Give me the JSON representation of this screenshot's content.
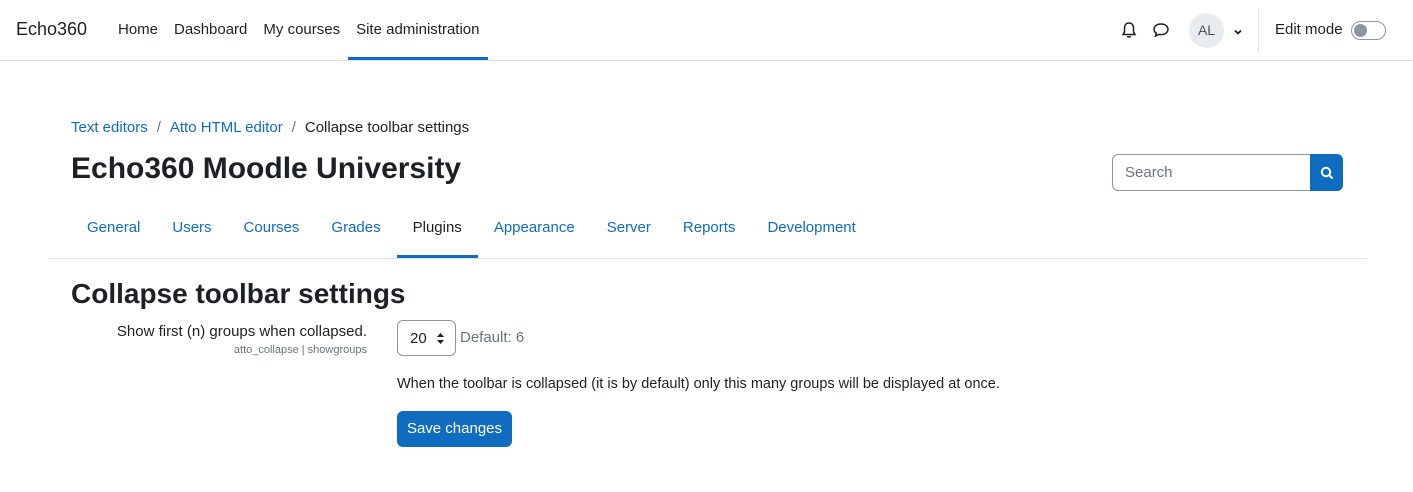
{
  "navbar": {
    "brand": "Echo360",
    "items": [
      {
        "label": "Home"
      },
      {
        "label": "Dashboard"
      },
      {
        "label": "My courses"
      },
      {
        "label": "Site administration"
      }
    ],
    "active_item": "Site administration",
    "avatar_initials": "AL",
    "edit_mode_label": "Edit mode",
    "edit_mode_on": false
  },
  "breadcrumb": {
    "items": [
      "Text editors",
      "Atto HTML editor"
    ],
    "current": "Collapse toolbar settings",
    "separator": "/"
  },
  "page_heading": "Echo360 Moodle University",
  "search": {
    "placeholder": "Search"
  },
  "tabs": [
    {
      "label": "General"
    },
    {
      "label": "Users"
    },
    {
      "label": "Courses"
    },
    {
      "label": "Grades"
    },
    {
      "label": "Plugins"
    },
    {
      "label": "Appearance"
    },
    {
      "label": "Server"
    },
    {
      "label": "Reports"
    },
    {
      "label": "Development"
    }
  ],
  "active_tab": "Plugins",
  "section_heading": "Collapse toolbar settings",
  "setting": {
    "label": "Show first (n) groups when collapsed.",
    "id": "atto_collapse | showgroups",
    "value": "20",
    "default": "Default: 6",
    "description": "When the toolbar is collapsed (it is by default) only this many groups will be displayed at once."
  },
  "save_label": "Save changes",
  "colors": {
    "primary": "#0f6cbf",
    "text": "#1d2125",
    "muted": "#6a737b",
    "border": "#dee2e6"
  }
}
